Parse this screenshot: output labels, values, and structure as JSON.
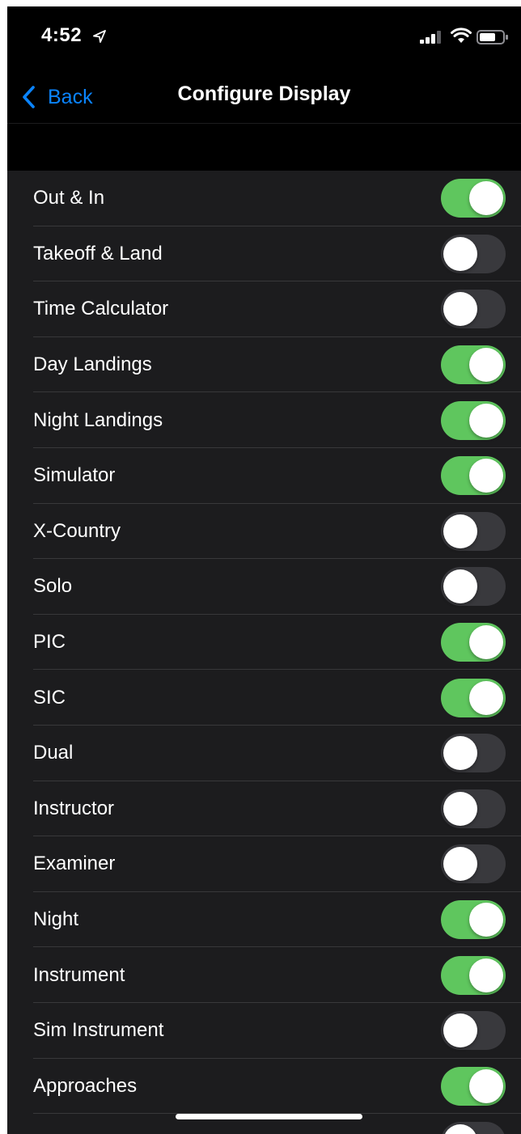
{
  "status_bar": {
    "time": "4:52"
  },
  "nav": {
    "back_label": "Back",
    "title": "Configure Display"
  },
  "colors": {
    "accent": "#0a84ff",
    "switch_on": "#5fc65e",
    "switch_off": "#39393d",
    "row_background": "#1c1c1e"
  },
  "settings": [
    {
      "label": "Out & In",
      "enabled": true
    },
    {
      "label": "Takeoff & Land",
      "enabled": false
    },
    {
      "label": "Time Calculator",
      "enabled": false
    },
    {
      "label": "Day Landings",
      "enabled": true
    },
    {
      "label": "Night Landings",
      "enabled": true
    },
    {
      "label": "Simulator",
      "enabled": true
    },
    {
      "label": "X-Country",
      "enabled": false
    },
    {
      "label": "Solo",
      "enabled": false
    },
    {
      "label": "PIC",
      "enabled": true
    },
    {
      "label": "SIC",
      "enabled": true
    },
    {
      "label": "Dual",
      "enabled": false
    },
    {
      "label": "Instructor",
      "enabled": false
    },
    {
      "label": "Examiner",
      "enabled": false
    },
    {
      "label": "Night",
      "enabled": true
    },
    {
      "label": "Instrument",
      "enabled": true
    },
    {
      "label": "Sim Instrument",
      "enabled": false
    },
    {
      "label": "Approaches",
      "enabled": true
    },
    {
      "label": "",
      "enabled": false
    }
  ]
}
